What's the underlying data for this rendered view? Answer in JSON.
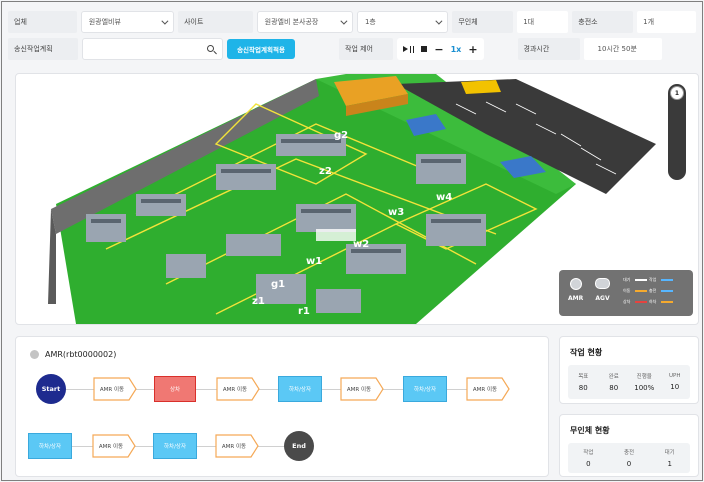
{
  "filters": {
    "company_label": "업체",
    "company_value": "원광엘비뷰",
    "site_label": "사이트",
    "site_value": "원광엘비 본사공장",
    "floor_value": "1층",
    "unmanned_label": "무인체",
    "unmanned_value": "1대",
    "charger_label": "충전소",
    "charger_value": "1개"
  },
  "plan": {
    "label": "송신작업계획",
    "search_placeholder": "",
    "primary_button": "송신작업계획적용",
    "control_label": "작업 제어",
    "speed": "1x",
    "elapsed_label": "경과시간",
    "elapsed_value": "10시간 50분"
  },
  "map": {
    "scroll_badge": "1",
    "zone_labels": [
      "g2",
      "z2",
      "w4",
      "w3",
      "w1",
      "w2",
      "g1",
      "z1",
      "r1"
    ],
    "legend": {
      "amr": "AMR",
      "agv": "AGV",
      "rows": [
        {
          "a": "대기",
          "b": "작업"
        },
        {
          "a": "이동",
          "b": "충전"
        },
        {
          "a": "상차",
          "b": "하차"
        }
      ],
      "colors": [
        "#ffffff",
        "#ffffff",
        "#f5a623",
        "#4fb3ff",
        "#e53935",
        "#f5a623"
      ]
    }
  },
  "flow": {
    "robot": "AMR(rbt0000002)",
    "start": "Start",
    "end": "End",
    "row1": [
      "AMR 이동",
      "상차",
      "AMR 이동",
      "하차/상자",
      "AMR 이동",
      "하차/상자",
      "AMR 이동"
    ],
    "row2": [
      "하차/상자",
      "AMR 이동",
      "하차/상자",
      "AMR 이동"
    ]
  },
  "work_status": {
    "title": "작업 현황",
    "headers": [
      "목표",
      "완료",
      "진행율",
      "UPH"
    ],
    "values": [
      "80",
      "80",
      "100%",
      "10"
    ]
  },
  "robot_status": {
    "title": "무인체 현황",
    "headers": [
      "작업",
      "충전",
      "대기"
    ],
    "values": [
      "0",
      "0",
      "1"
    ]
  }
}
